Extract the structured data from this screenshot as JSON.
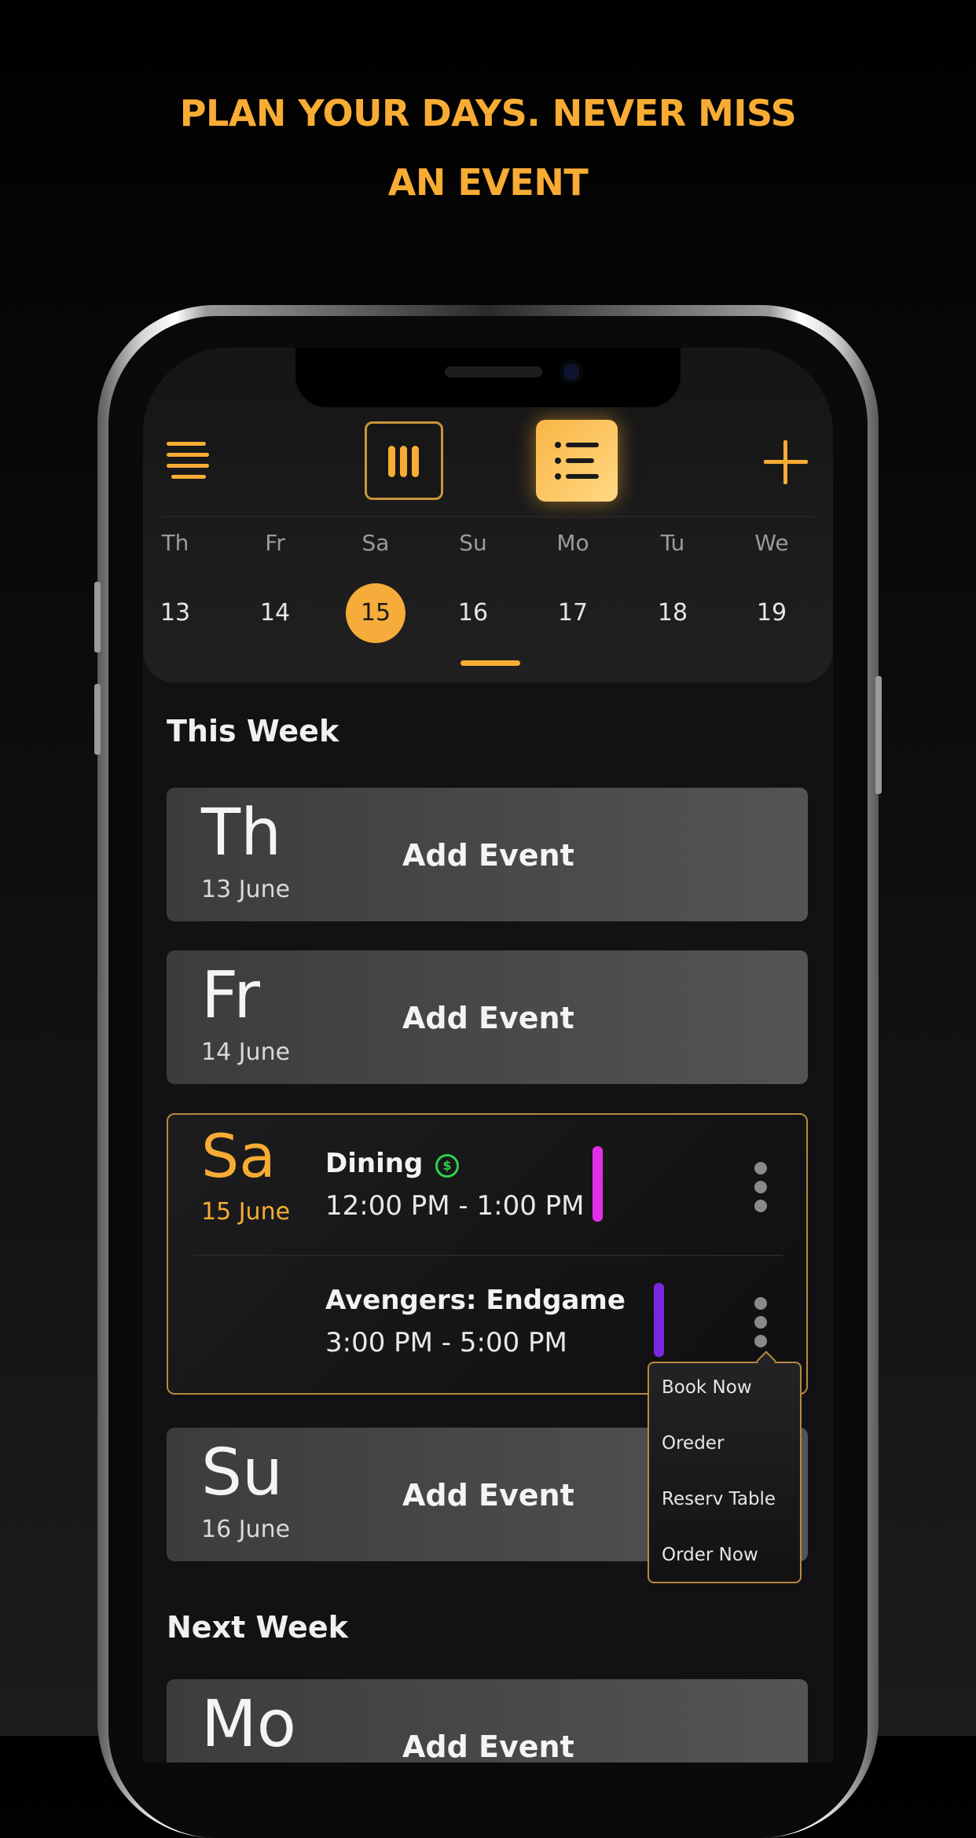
{
  "headline": {
    "line1": "PLAN YOUR DAYS. NEVER MISS",
    "line2": "AN EVENT"
  },
  "toolbar": {
    "menu_icon": "hamburger-icon",
    "columns_icon": "columns-view-icon",
    "list_icon": "list-view-icon",
    "add_icon": "plus-icon"
  },
  "week": [
    {
      "name": "Th",
      "num": "13"
    },
    {
      "name": "Fr",
      "num": "14"
    },
    {
      "name": "Sa",
      "num": "15",
      "selected": true
    },
    {
      "name": "Su",
      "num": "16"
    },
    {
      "name": "Mo",
      "num": "17"
    },
    {
      "name": "Tu",
      "num": "18"
    },
    {
      "name": "We",
      "num": "19"
    }
  ],
  "sections": {
    "this_week": "This Week",
    "next_week": "Next Week"
  },
  "cards": {
    "th": {
      "abbr": "Th",
      "date": "13 June",
      "action": "Add Event"
    },
    "fr": {
      "abbr": "Fr",
      "date": "14 June",
      "action": "Add Event"
    },
    "sa": {
      "abbr": "Sa",
      "date": "15 June",
      "events": [
        {
          "title": "Dining",
          "time": "12:00 PM - 1:00 PM",
          "color": "#e22ee8",
          "icon": "dollar-coin-icon"
        },
        {
          "title": "Avengers: Endgame",
          "time": "3:00 PM - 5:00 PM",
          "color": "#7a28e0"
        }
      ]
    },
    "su": {
      "abbr": "Su",
      "date": "16 June",
      "action": "Add Event"
    },
    "mo": {
      "abbr": "Mo",
      "action": "Add Event"
    }
  },
  "popup_menu": [
    "Book Now",
    "Oreder",
    "Reserv Table",
    "Order Now"
  ],
  "colors": {
    "accent": "#f8ac34",
    "card_gray": "#4a4a4c",
    "background": "#121214"
  }
}
